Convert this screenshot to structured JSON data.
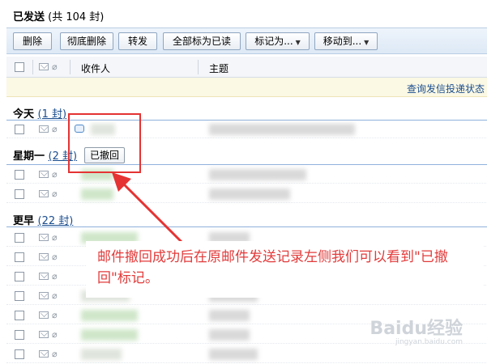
{
  "header": {
    "title": "已发送",
    "count_text": "(共 104 封)"
  },
  "toolbar": {
    "delete": "删除",
    "delete_permanently": "彻底删除",
    "forward": "转发",
    "mark_all_read": "全部标为已读",
    "mark_as": "标记为...",
    "move_to": "移动到..."
  },
  "columns": {
    "recipient": "收件人",
    "subject": "主题"
  },
  "notice": {
    "text": "查询发信投递状态"
  },
  "groups": {
    "today": {
      "label": "今天",
      "count": "(1 封)"
    },
    "monday": {
      "label": "星期一",
      "count": "(2 封)"
    },
    "earlier": {
      "label": "更早",
      "count": "(22 封)"
    }
  },
  "badge": {
    "recalled": "已撤回"
  },
  "annotation": {
    "text": "邮件撤回成功后在原邮件发送记录左侧我们可以看到\"已撤回\"标记。"
  },
  "watermark": {
    "brand": "Baidu经验",
    "url": "jingyan.baidu.com"
  },
  "colors": {
    "accent": "#1b4e8f",
    "annotation_red": "#e23b3b",
    "notice_bg": "#fbf8e4"
  },
  "icons": [
    "checkbox-icon",
    "envelope-icon",
    "paperclip-icon",
    "recall-icon",
    "arrow-icon"
  ]
}
